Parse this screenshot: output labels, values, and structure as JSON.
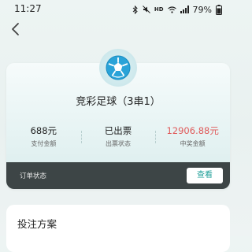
{
  "status_bar": {
    "time": "11:27",
    "battery_percent": "79%"
  },
  "icons": {
    "back": "back-chevron-icon",
    "ball": "football-icon"
  },
  "order": {
    "title": "竞彩足球（3串1）",
    "stats": [
      {
        "value": "688元",
        "label": "支付金额"
      },
      {
        "value": "已出票",
        "label": "出票状态"
      },
      {
        "value": "12906.88元",
        "label": "中奖金额"
      }
    ],
    "status_label": "订单状态",
    "view_button": "查看"
  },
  "plan": {
    "title": "投注方案"
  },
  "colors": {
    "prize": "#e05a5a",
    "accent": "#1f9f98",
    "bar": "#3d4546"
  }
}
